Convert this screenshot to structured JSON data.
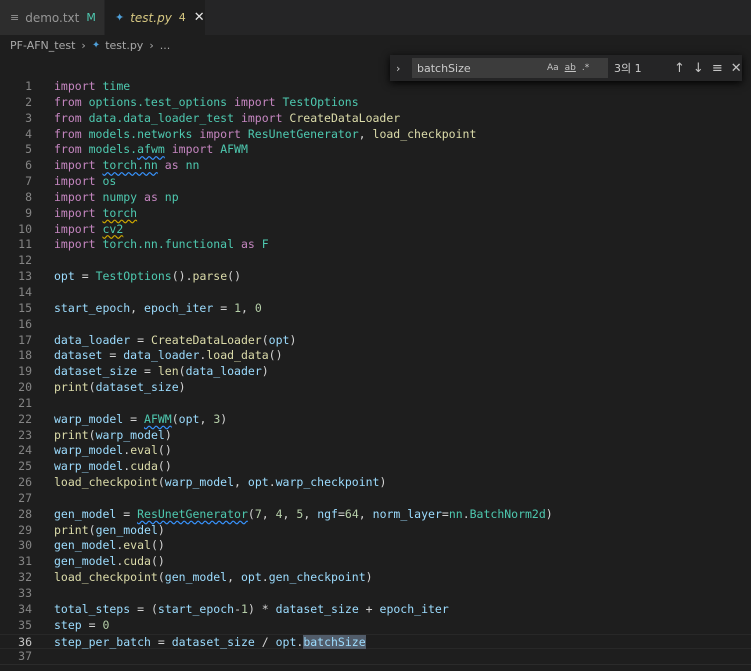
{
  "tabs": [
    {
      "icon": "≡",
      "name": "demo.txt",
      "status": "M"
    },
    {
      "icon": "✦",
      "name": "test.py",
      "status": "4",
      "close": "✕"
    }
  ],
  "breadcrumbs": {
    "folder": "PF-AFN_test",
    "file": "test.py",
    "more": "..."
  },
  "find": {
    "toggle": "›",
    "query": "batchSize",
    "opt_case": "Aa",
    "opt_word": "ab",
    "opt_regex": ".*",
    "count": "3의 1",
    "prev": "↑",
    "next": "↓",
    "selection": "≡",
    "close": "✕"
  },
  "lines": [
    {
      "n": "1",
      "t": [
        [
          "kw",
          "import "
        ],
        [
          "mod",
          "time"
        ]
      ]
    },
    {
      "n": "2",
      "t": [
        [
          "kw",
          "from "
        ],
        [
          "mod",
          "options.test_options "
        ],
        [
          "kw",
          "import "
        ],
        [
          "mod",
          "TestOptions"
        ]
      ]
    },
    {
      "n": "3",
      "t": [
        [
          "kw",
          "from "
        ],
        [
          "mod",
          "data.data_loader_test "
        ],
        [
          "kw",
          "import "
        ],
        [
          "fn",
          "CreateDataLoader"
        ]
      ]
    },
    {
      "n": "4",
      "t": [
        [
          "kw",
          "from "
        ],
        [
          "mod",
          "models.networks "
        ],
        [
          "kw",
          "import "
        ],
        [
          "mod",
          "ResUnetGenerator"
        ],
        [
          "plain",
          ", "
        ],
        [
          "fn",
          "load_checkpoint"
        ]
      ]
    },
    {
      "n": "5",
      "t": [
        [
          "kw",
          "from "
        ],
        [
          "mod",
          "models."
        ],
        [
          "mod sq-blue",
          "afwm"
        ],
        [
          "kw",
          " import "
        ],
        [
          "mod",
          "AFWM"
        ]
      ]
    },
    {
      "n": "6",
      "t": [
        [
          "kw",
          "import "
        ],
        [
          "mod sq-blue",
          "torch.nn"
        ],
        [
          "kw",
          " as "
        ],
        [
          "mod",
          "nn"
        ]
      ]
    },
    {
      "n": "7",
      "t": [
        [
          "kw",
          "import "
        ],
        [
          "mod",
          "os"
        ]
      ]
    },
    {
      "n": "8",
      "t": [
        [
          "kw",
          "import "
        ],
        [
          "mod",
          "numpy"
        ],
        [
          "kw",
          " as "
        ],
        [
          "mod",
          "np"
        ]
      ]
    },
    {
      "n": "9",
      "t": [
        [
          "kw",
          "import "
        ],
        [
          "mod sq-yellow",
          "torch"
        ]
      ]
    },
    {
      "n": "10",
      "t": [
        [
          "kw",
          "import "
        ],
        [
          "mod sq-yellow",
          "cv2"
        ]
      ]
    },
    {
      "n": "11",
      "t": [
        [
          "kw",
          "import "
        ],
        [
          "mod",
          "torch.nn.functional"
        ],
        [
          "kw",
          " as "
        ],
        [
          "mod",
          "F"
        ]
      ]
    },
    {
      "n": "12",
      "t": []
    },
    {
      "n": "13",
      "t": [
        [
          "var",
          "opt"
        ],
        [
          "op",
          " = "
        ],
        [
          "mod",
          "TestOptions"
        ],
        [
          "plain",
          "()."
        ],
        [
          "fn",
          "parse"
        ],
        [
          "plain",
          "()"
        ]
      ]
    },
    {
      "n": "14",
      "t": []
    },
    {
      "n": "15",
      "t": [
        [
          "var",
          "start_epoch"
        ],
        [
          "plain",
          ", "
        ],
        [
          "var",
          "epoch_iter"
        ],
        [
          "op",
          " = "
        ],
        [
          "num",
          "1"
        ],
        [
          "plain",
          ", "
        ],
        [
          "num",
          "0"
        ]
      ]
    },
    {
      "n": "16",
      "t": []
    },
    {
      "n": "17",
      "t": [
        [
          "var",
          "data_loader"
        ],
        [
          "op",
          " = "
        ],
        [
          "fn",
          "CreateDataLoader"
        ],
        [
          "plain",
          "("
        ],
        [
          "var",
          "opt"
        ],
        [
          "plain",
          ")"
        ]
      ]
    },
    {
      "n": "18",
      "t": [
        [
          "var",
          "dataset"
        ],
        [
          "op",
          " = "
        ],
        [
          "var",
          "data_loader"
        ],
        [
          "plain",
          "."
        ],
        [
          "fn",
          "load_data"
        ],
        [
          "plain",
          "()"
        ]
      ]
    },
    {
      "n": "19",
      "t": [
        [
          "var",
          "dataset_size"
        ],
        [
          "op",
          " = "
        ],
        [
          "fn",
          "len"
        ],
        [
          "plain",
          "("
        ],
        [
          "var",
          "data_loader"
        ],
        [
          "plain",
          ")"
        ]
      ]
    },
    {
      "n": "20",
      "t": [
        [
          "fn",
          "print"
        ],
        [
          "plain",
          "("
        ],
        [
          "var",
          "dataset_size"
        ],
        [
          "plain",
          ")"
        ]
      ]
    },
    {
      "n": "21",
      "t": []
    },
    {
      "n": "22",
      "t": [
        [
          "var",
          "warp_model"
        ],
        [
          "op",
          " = "
        ],
        [
          "mod sq-blue",
          "AFWM"
        ],
        [
          "plain",
          "("
        ],
        [
          "var",
          "opt"
        ],
        [
          "plain",
          ", "
        ],
        [
          "num",
          "3"
        ],
        [
          "plain",
          ")"
        ]
      ]
    },
    {
      "n": "23",
      "t": [
        [
          "fn",
          "print"
        ],
        [
          "plain",
          "("
        ],
        [
          "var",
          "warp_model"
        ],
        [
          "plain",
          ")"
        ]
      ]
    },
    {
      "n": "24",
      "t": [
        [
          "var",
          "warp_model"
        ],
        [
          "plain",
          "."
        ],
        [
          "fn",
          "eval"
        ],
        [
          "plain",
          "()"
        ]
      ]
    },
    {
      "n": "25",
      "t": [
        [
          "var",
          "warp_model"
        ],
        [
          "plain",
          "."
        ],
        [
          "fn",
          "cuda"
        ],
        [
          "plain",
          "()"
        ]
      ]
    },
    {
      "n": "26",
      "t": [
        [
          "fn",
          "load_checkpoint"
        ],
        [
          "plain",
          "("
        ],
        [
          "var",
          "warp_model"
        ],
        [
          "plain",
          ", "
        ],
        [
          "var",
          "opt"
        ],
        [
          "plain",
          "."
        ],
        [
          "var",
          "warp_checkpoint"
        ],
        [
          "plain",
          ")"
        ]
      ]
    },
    {
      "n": "27",
      "t": []
    },
    {
      "n": "28",
      "t": [
        [
          "var",
          "gen_model"
        ],
        [
          "op",
          " = "
        ],
        [
          "mod sq-blue",
          "ResUnetGenerator"
        ],
        [
          "plain",
          "("
        ],
        [
          "num",
          "7"
        ],
        [
          "plain",
          ", "
        ],
        [
          "num",
          "4"
        ],
        [
          "plain",
          ", "
        ],
        [
          "num",
          "5"
        ],
        [
          "plain",
          ", "
        ],
        [
          "var",
          "ngf"
        ],
        [
          "op",
          "="
        ],
        [
          "num",
          "64"
        ],
        [
          "plain",
          ", "
        ],
        [
          "var",
          "norm_layer"
        ],
        [
          "op",
          "="
        ],
        [
          "mod",
          "nn"
        ],
        [
          "plain",
          "."
        ],
        [
          "mod",
          "BatchNorm2d"
        ],
        [
          "plain",
          ")"
        ]
      ]
    },
    {
      "n": "29",
      "t": [
        [
          "fn",
          "print"
        ],
        [
          "plain",
          "("
        ],
        [
          "var",
          "gen_model"
        ],
        [
          "plain",
          ")"
        ]
      ]
    },
    {
      "n": "30",
      "t": [
        [
          "var",
          "gen_model"
        ],
        [
          "plain",
          "."
        ],
        [
          "fn",
          "eval"
        ],
        [
          "plain",
          "()"
        ]
      ]
    },
    {
      "n": "31",
      "t": [
        [
          "var",
          "gen_model"
        ],
        [
          "plain",
          "."
        ],
        [
          "fn",
          "cuda"
        ],
        [
          "plain",
          "()"
        ]
      ]
    },
    {
      "n": "32",
      "t": [
        [
          "fn",
          "load_checkpoint"
        ],
        [
          "plain",
          "("
        ],
        [
          "var",
          "gen_model"
        ],
        [
          "plain",
          ", "
        ],
        [
          "var",
          "opt"
        ],
        [
          "plain",
          "."
        ],
        [
          "var",
          "gen_checkpoint"
        ],
        [
          "plain",
          ")"
        ]
      ]
    },
    {
      "n": "33",
      "t": []
    },
    {
      "n": "34",
      "t": [
        [
          "var",
          "total_steps"
        ],
        [
          "op",
          " = "
        ],
        [
          "plain",
          "("
        ],
        [
          "var",
          "start_epoch"
        ],
        [
          "op",
          "-"
        ],
        [
          "num",
          "1"
        ],
        [
          "plain",
          ") "
        ],
        [
          "op",
          "* "
        ],
        [
          "var",
          "dataset_size"
        ],
        [
          "op",
          " + "
        ],
        [
          "var",
          "epoch_iter"
        ]
      ]
    },
    {
      "n": "35",
      "t": [
        [
          "var",
          "step"
        ],
        [
          "op",
          " = "
        ],
        [
          "num",
          "0"
        ]
      ]
    },
    {
      "n": "36",
      "t": [
        [
          "var",
          "step_per_batch"
        ],
        [
          "op",
          " = "
        ],
        [
          "var",
          "dataset_size"
        ],
        [
          "op",
          " / "
        ],
        [
          "var",
          "opt"
        ],
        [
          "plain",
          "."
        ],
        [
          "var hl",
          "batchSize"
        ]
      ]
    },
    {
      "n": "37",
      "t": []
    }
  ],
  "current_line": "36"
}
